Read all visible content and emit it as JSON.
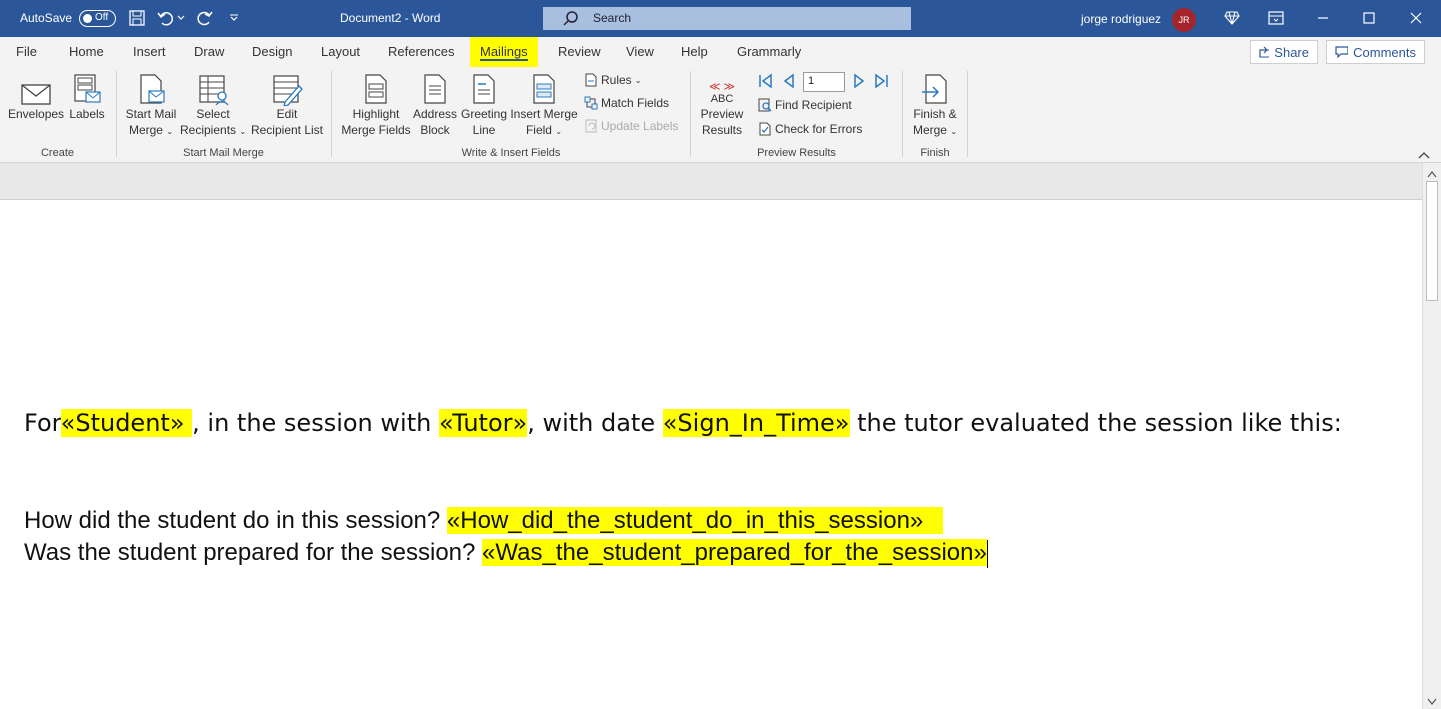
{
  "titlebar": {
    "autosave_label": "AutoSave",
    "autosave_state": "Off",
    "document_title": "Document2 - Word",
    "search_placeholder": "Search",
    "user_name": "jorge rodriguez",
    "user_initials": "JR",
    "bg_color": "#2b579a"
  },
  "tabs": [
    "File",
    "Home",
    "Insert",
    "Draw",
    "Design",
    "Layout",
    "References",
    "Mailings",
    "Review",
    "View",
    "Help",
    "Grammarly"
  ],
  "active_tab": "Mailings",
  "top_buttons": {
    "share": "Share",
    "comments": "Comments"
  },
  "ribbon": {
    "create": {
      "label": "Create",
      "envelopes": "Envelopes",
      "labels": "Labels"
    },
    "start_mail_merge": {
      "label": "Start Mail Merge",
      "start_line1": "Start Mail",
      "start_line2": "Merge",
      "select_line1": "Select",
      "select_line2": "Recipients",
      "edit_line1": "Edit",
      "edit_line2": "Recipient List"
    },
    "write_insert": {
      "label": "Write & Insert Fields",
      "highlight_line1": "Highlight",
      "highlight_line2": "Merge Fields",
      "address_line1": "Address",
      "address_line2": "Block",
      "greeting_line1": "Greeting",
      "greeting_line2": "Line",
      "insert_line1": "Insert Merge",
      "insert_line2": "Field",
      "rules": "Rules",
      "match_fields": "Match Fields",
      "update_labels": "Update Labels"
    },
    "preview": {
      "label": "Preview Results",
      "preview_icon_text": "ABC",
      "preview_line1": "Preview",
      "preview_line2": "Results",
      "record_number": "1",
      "find_recipient": "Find Recipient",
      "check_errors": "Check for Errors"
    },
    "finish": {
      "label": "Finish",
      "finish_line1": "Finish &",
      "finish_line2": "Merge"
    }
  },
  "document": {
    "p1_for": "For",
    "p1_field_student": "«Student» ",
    "p1_mid1": ", in the session with ",
    "p1_field_tutor": "«Tutor»",
    "p1_mid2": ", with date ",
    "p1_field_signin": "«Sign_In_Time»",
    "p1_end": " the tutor evaluated the session like this:",
    "q1": "How did the student do in this session? ",
    "q1_field": "«How_did_the_student_do_in_this_session»   ",
    "q2": "Was the student prepared for the session? ",
    "q2_field": "«Was_the_student_prepared_for_the_session»"
  },
  "colors": {
    "highlight": "#ffff00",
    "accent": "#2b579a"
  }
}
